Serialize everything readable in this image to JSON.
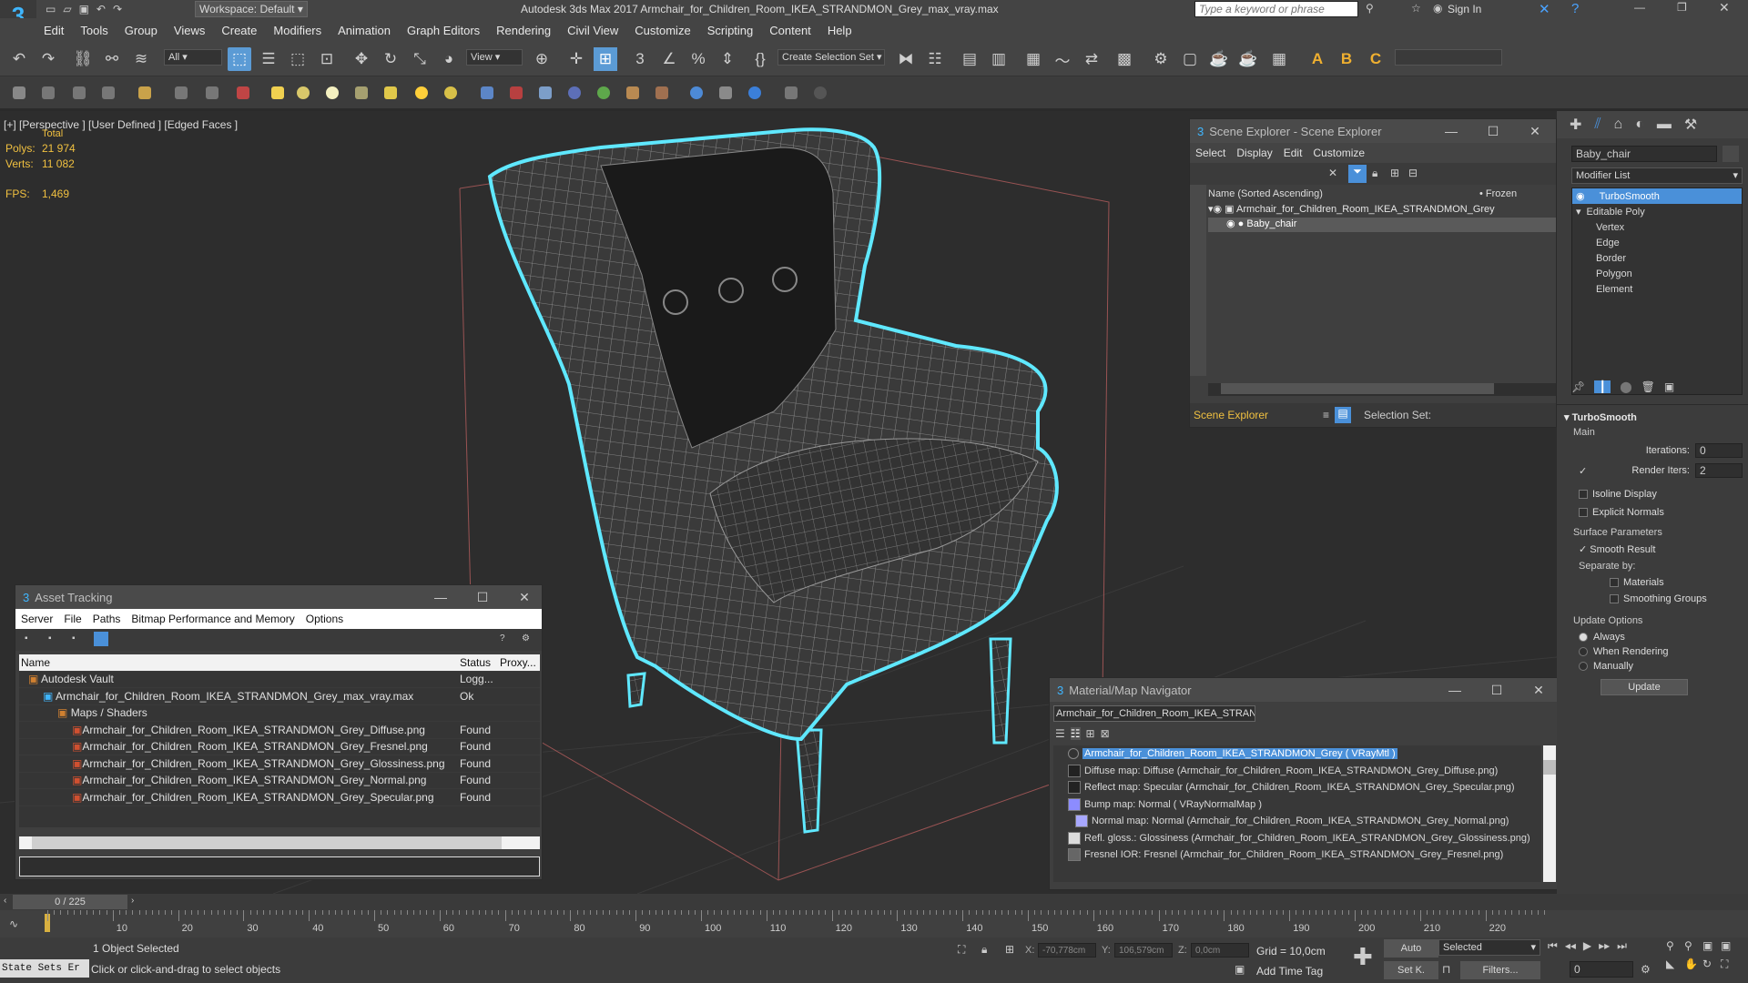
{
  "app": {
    "workspace_label": "Workspace: Default",
    "title": "Autodesk 3ds Max 2017    Armchair_for_Children_Room_IKEA_STRANDMON_Grey_max_vray.max",
    "search_placeholder": "Type a keyword or phrase",
    "sign_in": "Sign In"
  },
  "menu": [
    "Edit",
    "Tools",
    "Group",
    "Views",
    "Create",
    "Modifiers",
    "Animation",
    "Graph Editors",
    "Rendering",
    "Civil View",
    "Customize",
    "Scripting",
    "Content",
    "Help"
  ],
  "toolbar": {
    "filter_all": "All",
    "view_dropdown": "View",
    "create_selection_set": "Create Selection Set"
  },
  "viewport": {
    "label": "[+] [Perspective ]  [User Defined ] [Edged Faces ]",
    "stats_header": "Total",
    "polys_label": "Polys:",
    "polys_value": "21 974",
    "verts_label": "Verts:",
    "verts_value": "11 082",
    "fps_label": "FPS:",
    "fps_value": "1,469"
  },
  "scene_explorer": {
    "title": "Scene Explorer - Scene Explorer",
    "menu": [
      "Select",
      "Display",
      "Edit",
      "Customize"
    ],
    "col_name": "Name (Sorted Ascending)",
    "col_frozen": "• Frozen",
    "rows": [
      "Armchair_for_Children_Room_IKEA_STRANDMON_Grey",
      "Baby_chair"
    ],
    "footer_left": "Scene Explorer",
    "footer_right": "Selection Set:"
  },
  "asset_tracking": {
    "title": "Asset Tracking",
    "menu": [
      "Server",
      "File",
      "Paths",
      "Bitmap Performance and Memory",
      "Options"
    ],
    "headers": [
      "Name",
      "Status",
      "Proxy..."
    ],
    "rows": [
      {
        "name": "Autodesk Vault",
        "status": "Logg...",
        "indent": 0
      },
      {
        "name": "Armchair_for_Children_Room_IKEA_STRANDMON_Grey_max_vray.max",
        "status": "Ok",
        "indent": 1
      },
      {
        "name": "Maps / Shaders",
        "status": "",
        "indent": 2
      },
      {
        "name": "Armchair_for_Children_Room_IKEA_STRANDMON_Grey_Diffuse.png",
        "status": "Found",
        "indent": 3
      },
      {
        "name": "Armchair_for_Children_Room_IKEA_STRANDMON_Grey_Fresnel.png",
        "status": "Found",
        "indent": 3
      },
      {
        "name": "Armchair_for_Children_Room_IKEA_STRANDMON_Grey_Glossiness.png",
        "status": "Found",
        "indent": 3
      },
      {
        "name": "Armchair_for_Children_Room_IKEA_STRANDMON_Grey_Normal.png",
        "status": "Found",
        "indent": 3
      },
      {
        "name": "Armchair_for_Children_Room_IKEA_STRANDMON_Grey_Specular.png",
        "status": "Found",
        "indent": 3
      }
    ]
  },
  "material_navigator": {
    "title": "Material/Map Navigator",
    "field": "Armchair_for_Children_Room_IKEA_STRANDM",
    "items": [
      "Armchair_for_Children_Room_IKEA_STRANDMON_Grey  ( VRayMtl )",
      "Diffuse map: Diffuse (Armchair_for_Children_Room_IKEA_STRANDMON_Grey_Diffuse.png)",
      "Reflect map: Specular (Armchair_for_Children_Room_IKEA_STRANDMON_Grey_Specular.png)",
      "Bump map: Normal  ( VRayNormalMap )",
      "Normal map: Normal (Armchair_for_Children_Room_IKEA_STRANDMON_Grey_Normal.png)",
      "Refl. gloss.: Glossiness (Armchair_for_Children_Room_IKEA_STRANDMON_Grey_Glossiness.png)",
      "Fresnel IOR: Fresnel (Armchair_for_Children_Room_IKEA_STRANDMON_Grey_Fresnel.png)"
    ]
  },
  "command_panel": {
    "object_name": "Baby_chair",
    "modifier_list": "Modifier List",
    "stack": [
      "TurboSmooth",
      "Editable Poly",
      "Vertex",
      "Edge",
      "Border",
      "Polygon",
      "Element"
    ],
    "rollout_title": "TurboSmooth",
    "main_label": "Main",
    "iterations_label": "Iterations:",
    "iterations_value": "0",
    "render_iters_label": "Render Iters:",
    "render_iters_value": "2",
    "isoline_display": "Isoline Display",
    "explicit_normals": "Explicit Normals",
    "surface_params": "Surface Parameters",
    "smooth_result": "Smooth Result",
    "separate_by": "Separate by:",
    "materials": "Materials",
    "smoothing_groups": "Smoothing Groups",
    "update_options": "Update Options",
    "always": "Always",
    "when_rendering": "When Rendering",
    "manually": "Manually",
    "update_button": "Update"
  },
  "timeline": {
    "frame_counter": "0 / 225",
    "ticks": [
      "0",
      "10",
      "20",
      "30",
      "40",
      "50",
      "60",
      "70",
      "80",
      "90",
      "100",
      "110",
      "120",
      "130",
      "140",
      "150",
      "160",
      "170",
      "180",
      "190",
      "200",
      "210",
      "220"
    ]
  },
  "status": {
    "state_sets": "State Sets Er",
    "selection": "1 Object Selected",
    "prompt": "Click or click-and-drag to select objects",
    "x_label": "X:",
    "x_value": "-70,778cm",
    "y_label": "Y:",
    "y_value": "106,579cm",
    "z_label": "Z:",
    "z_value": "0,0cm",
    "grid": "Grid = 10,0cm",
    "add_time_tag": "Add Time Tag",
    "auto": "Auto",
    "selected": "Selected",
    "set_k": "Set K.",
    "filters": "Filters...",
    "frame_value": "0"
  },
  "colors": {
    "accent": "#3fb6ff",
    "highlight": "#4a90d9",
    "selection_outline": "#5fe8ff",
    "stats": "#f0c040"
  }
}
